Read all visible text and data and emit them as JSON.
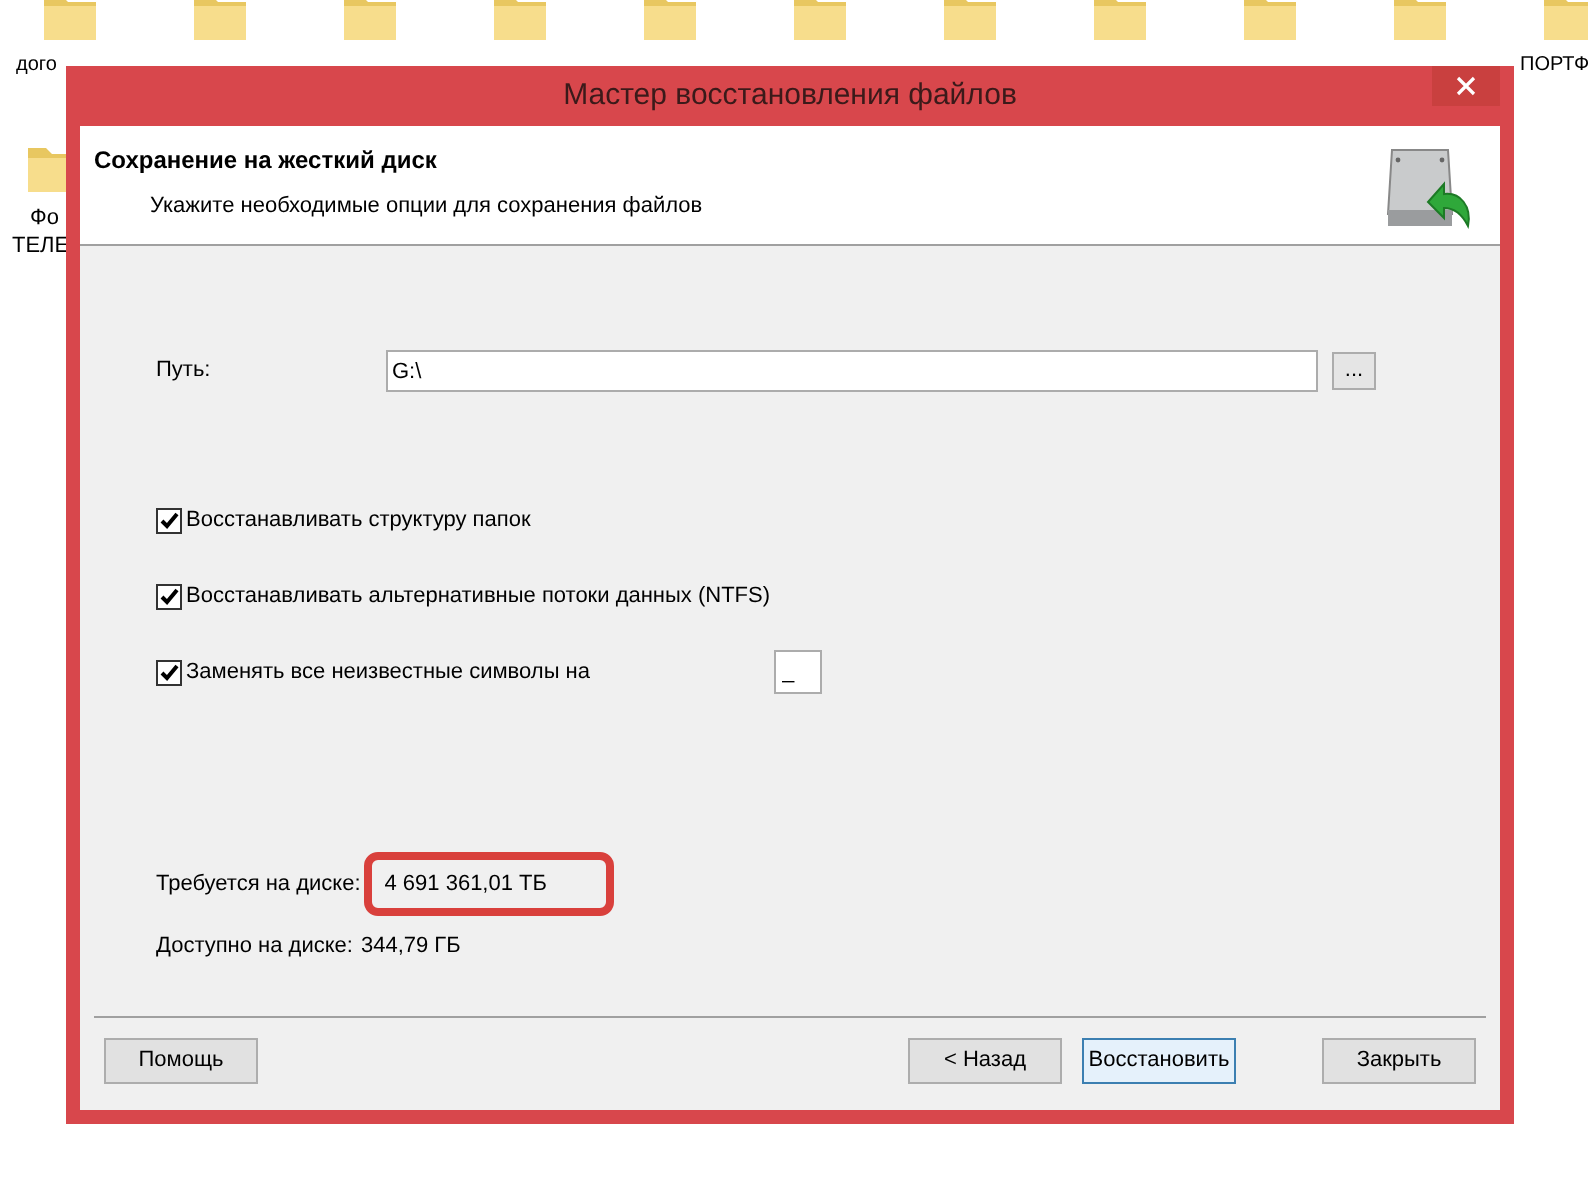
{
  "desktop_icons": [
    {
      "label": "дого"
    },
    {
      "label": "ПОРТФ"
    }
  ],
  "desktop_icons_row2": [
    {
      "label": "Фо",
      "label2": "ТЕЛЕ"
    }
  ],
  "window": {
    "title": "Мастер восстановления файлов"
  },
  "header": {
    "title": "Сохранение на жесткий диск",
    "subtitle": "Укажите необходимые опции для сохранения файлов"
  },
  "path": {
    "label": "Путь:",
    "value": "G:\\",
    "browse": "..."
  },
  "options": [
    {
      "label": "Восстанавливать структуру папок",
      "checked": true
    },
    {
      "label": "Восстанавливать альтернативные потоки данных (NTFS)",
      "checked": true
    },
    {
      "label": "Заменять все неизвестные символы на",
      "checked": true,
      "value": "_"
    }
  ],
  "required": {
    "label": "Требуется на диске:",
    "value": "4 691 361,01 ТБ",
    "highlighted": true
  },
  "available": {
    "label": "Доступно на диске:",
    "value": "344,79 ГБ"
  },
  "buttons": [
    {
      "label": "Помощь",
      "selected": false
    },
    {
      "label": "< Назад",
      "selected": false
    },
    {
      "label": "Восстановить",
      "selected": true
    },
    {
      "label": "Закрыть",
      "selected": false
    }
  ]
}
